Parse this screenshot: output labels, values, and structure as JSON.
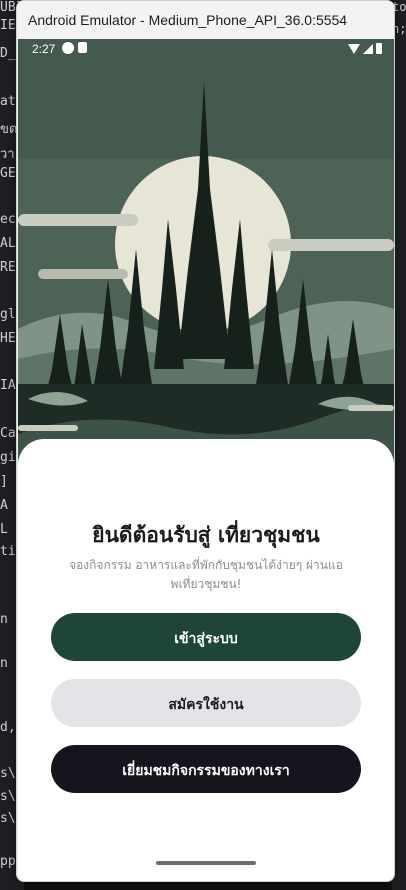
{
  "window": {
    "title": "Android Emulator - Medium_Phone_API_36.0:5554"
  },
  "status_bar": {
    "time": "2:27"
  },
  "sheet": {
    "welcome_title": "ยินดีต้อนรับสู่ เที่ยวชุมชน",
    "subtitle": "จองกิจกรรม อาหารและที่พักกับชุมชนได้ง่ายๆ ผ่านแอพเที่ยวชุมชน!",
    "login_label": "เข้าสู่ระบบ",
    "register_label": "สมัครใช้งาน",
    "visit_label": "เยี่ยมชมกิจกรรมของทางเรา"
  },
  "background_ide": {
    "left_lines": [
      "UBI",
      "IE",
      "D_",
      "at",
      "ขต",
      "วา",
      "GE",
      "ec",
      "AL",
      "RE",
      "gl",
      "HE",
      "IA",
      "Ca",
      "gi",
      "]",
      "A",
      "L",
      "ti",
      "n",
      "n",
      "d,",
      "s\\",
      "s\\",
      "s\\",
      "pp"
    ],
    "right_lines": [
      "to",
      "n;"
    ]
  },
  "colors": {
    "primary": "#1e4535",
    "secondary": "#e2e4e8",
    "dark": "#15151d",
    "sky": "#4a5f52",
    "sun": "#e6e4d6"
  }
}
